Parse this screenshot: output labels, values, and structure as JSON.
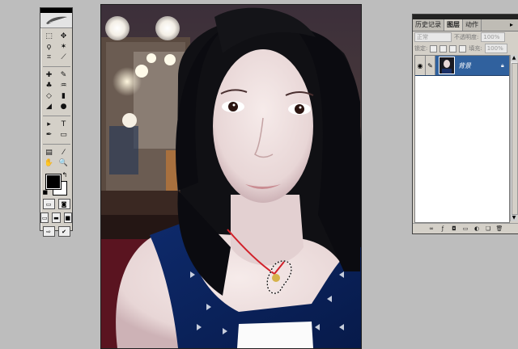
{
  "toolbox": {
    "tools": [
      "marquee-tool",
      "move-tool",
      "lasso-tool",
      "magic-wand-tool",
      "crop-tool",
      "slice-tool",
      "healing-brush-tool",
      "brush-tool",
      "clone-stamp-tool",
      "history-brush-tool",
      "eraser-tool",
      "gradient-tool",
      "blur-tool",
      "dodge-tool",
      "path-selection-tool",
      "type-tool",
      "pen-tool",
      "shape-tool",
      "notes-tool",
      "eyedropper-tool",
      "hand-tool",
      "zoom-tool"
    ],
    "glyphs": [
      "⬚",
      "✥",
      "ϙ",
      "✶",
      "⌗",
      "⟋",
      "✚",
      "✎",
      "♣",
      "♒",
      "◇",
      "▮",
      "◢",
      "●",
      "▸",
      "T",
      "✒",
      "▭",
      "▤",
      "⁄",
      "✋",
      "🔍"
    ],
    "foreground_color": "#000000",
    "background_color": "#ffffff"
  },
  "layers_panel": {
    "tabs": [
      "历史记录",
      "图层",
      "动作"
    ],
    "active_tab": "图层",
    "blend_mode": "正常",
    "opacity_label": "不透明度:",
    "opacity_value": "100%",
    "lock_label": "锁定:",
    "fill_label": "填充:",
    "fill_value": "100%",
    "layers": [
      {
        "name": "背景",
        "visible": true,
        "selected": true
      }
    ],
    "selected_color": "#30619e"
  }
}
